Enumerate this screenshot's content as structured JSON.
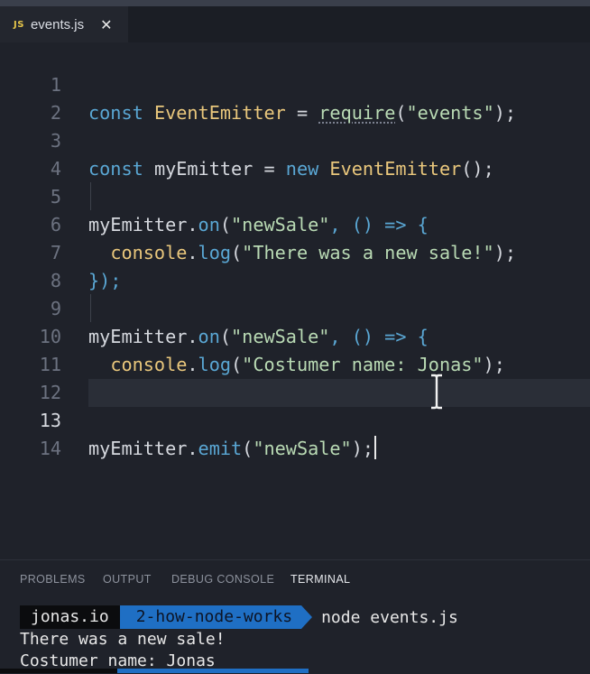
{
  "tab": {
    "lang_badge": "JS",
    "filename": "events.js",
    "close_glyph": "✕"
  },
  "editor": {
    "lines": [
      {
        "n": "1"
      },
      {
        "n": "2"
      },
      {
        "n": "3"
      },
      {
        "n": "4"
      },
      {
        "n": "5"
      },
      {
        "n": "6"
      },
      {
        "n": "7"
      },
      {
        "n": "8"
      },
      {
        "n": "9"
      },
      {
        "n": "10"
      },
      {
        "n": "11"
      },
      {
        "n": "12"
      },
      {
        "n": "13"
      },
      {
        "n": "14"
      }
    ],
    "tokens": {
      "const": "const",
      "event_emitter": "EventEmitter",
      "eq": " = ",
      "require": "require",
      "events_str": "\"events\"",
      "my_emitter": "myEmitter",
      "new_kw": "new",
      "on": "on",
      "new_sale_str": "\"newSale\"",
      "arrow": ", () => {",
      "console": "console",
      "log": "log",
      "msg1": "\"There was a new sale!\"",
      "msg2": "\"Costumer name: Jonas\"",
      "close_block": "});",
      "emit": "emit"
    },
    "active_line": 13
  },
  "panel": {
    "tabs": [
      "PROBLEMS",
      "OUTPUT",
      "DEBUG CONSOLE",
      "TERMINAL"
    ],
    "active_tab": "TERMINAL"
  },
  "terminal": {
    "host": "jonas.io",
    "dir": "2-how-node-works",
    "command": "node events.js",
    "output": [
      "There was a new sale!",
      "Costumer name: Jonas"
    ]
  },
  "colors": {
    "keyword": "#5aa7d4",
    "string": "#b9dab4",
    "object": "#e9c77c",
    "js_badge": "#e6c64a",
    "prompt_dir_bg": "#1f6fc4"
  },
  "icons": {
    "close": "close-icon",
    "cursor": "text-cursor-icon"
  }
}
